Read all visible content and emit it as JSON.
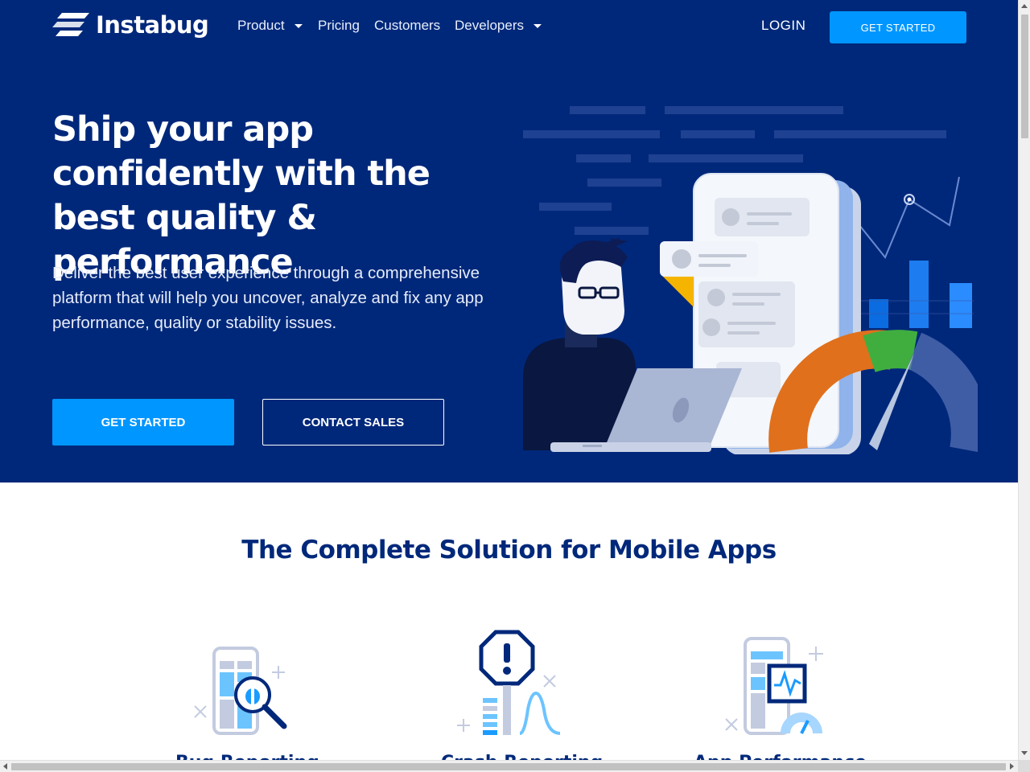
{
  "brand": {
    "name": "Instabug"
  },
  "nav": {
    "items": [
      {
        "label": "Product",
        "has_dropdown": true
      },
      {
        "label": "Pricing",
        "has_dropdown": false
      },
      {
        "label": "Customers",
        "has_dropdown": false
      },
      {
        "label": "Developers",
        "has_dropdown": true
      }
    ],
    "login_label": "LOGIN",
    "cta_label": "GET STARTED"
  },
  "hero": {
    "headline": "Ship your app confidently with the best quality & performance",
    "subtext": "Deliver the best user experience through a comprehensive platform that will help you uncover, analyze and fix any app performance, quality or stability issues.",
    "primary_cta": "GET STARTED",
    "secondary_cta": "CONTACT SALES"
  },
  "solutions": {
    "title": "The Complete Solution for Mobile Apps",
    "features": [
      {
        "label": "Bug Reporting",
        "icon": "bug-search-icon"
      },
      {
        "label": "Crash Reporting",
        "icon": "crash-alert-icon"
      },
      {
        "label": "App Performance",
        "icon": "performance-monitor-icon"
      }
    ]
  },
  "colors": {
    "hero_bg": "#00287a",
    "accent": "#0096ff",
    "heading": "#00287a"
  }
}
